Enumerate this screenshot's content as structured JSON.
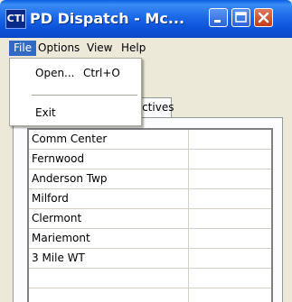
{
  "window": {
    "app_icon_text": "CTI",
    "title": "PD Dispatch - Mc..."
  },
  "menubar": {
    "items": [
      "File",
      "Options",
      "View",
      "Help"
    ]
  },
  "file_menu": {
    "open_label": "Open...",
    "open_shortcut": "Ctrl+O",
    "exit_label": "Exit"
  },
  "tabs": {
    "partial_label": "tectives"
  },
  "list": {
    "rows": [
      "Comm Center",
      "Fernwood",
      "Anderson Twp",
      "Milford",
      "Clermont",
      "Mariemont",
      "3 Mile WT",
      "",
      ""
    ]
  },
  "colors": {
    "titlebar": "#0b52d9",
    "menu_highlight": "#316ac5",
    "close_button": "#c33b16"
  }
}
